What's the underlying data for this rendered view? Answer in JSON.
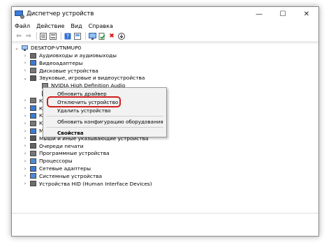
{
  "window": {
    "title": "Диспетчер устройств"
  },
  "window_controls": [
    "—",
    "☐",
    "✕"
  ],
  "menu": [
    "Файл",
    "Действие",
    "Вид",
    "Справка"
  ],
  "tree": {
    "root": "DESKTOP-VTNMUP0",
    "items": [
      {
        "label": "Аудиовходы и аудиовыходы",
        "expander": "›"
      },
      {
        "label": "Видеоадаптеры",
        "expander": "›"
      },
      {
        "label": "Дисковые устройства",
        "expander": "›"
      },
      {
        "label": "Звуковые, игровые и видеоустройства",
        "expander": "⌄"
      },
      {
        "label": "NVIDIA High Definition Audio",
        "expander": ""
      },
      {
        "label": "",
        "expander": ""
      },
      {
        "label": "Кл",
        "expander": "›"
      },
      {
        "label": "Ко",
        "expander": "›"
      },
      {
        "label": "Ко",
        "expander": "›"
      },
      {
        "label": "Ко",
        "expander": "›"
      },
      {
        "label": "Мо",
        "expander": "›"
      },
      {
        "label": "Мыши и иные указывающие устройства",
        "expander": "›"
      },
      {
        "label": "Очереди печати",
        "expander": "›"
      },
      {
        "label": "Программные устройства",
        "expander": "›"
      },
      {
        "label": "Процессоры",
        "expander": "›"
      },
      {
        "label": "Сетевые адаптеры",
        "expander": "›"
      },
      {
        "label": "Системные устройства",
        "expander": "›"
      },
      {
        "label": "Устройства HID (Human Interface Devices)",
        "expander": "›"
      }
    ]
  },
  "context_menu": {
    "update": "Обновить драйвер",
    "disable": "Отключить устройство",
    "remove": "Удалить устройство",
    "scan": "Обновить конфигурацию оборудования",
    "properties": "Свойства"
  }
}
